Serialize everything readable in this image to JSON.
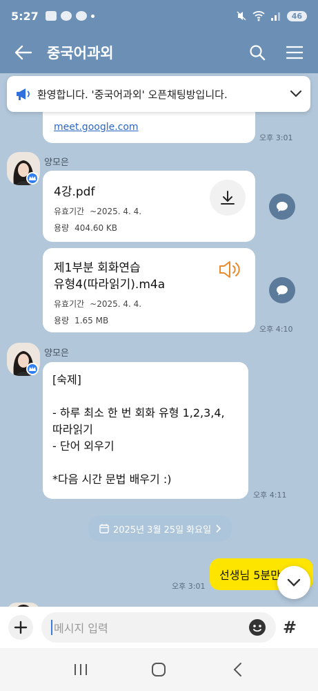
{
  "status_bar": {
    "time": "5:27",
    "battery": "46",
    "small_icon_text": "TALK"
  },
  "header": {
    "title": "중국어과외"
  },
  "notice": {
    "text": "환영합니다. '중국어과외' 오픈채팅방입니다."
  },
  "messages": {
    "link_message": {
      "link": "meet.google.com",
      "time": "오후 3:01"
    },
    "sender1": {
      "name": "양모은"
    },
    "file1": {
      "name": "4강.pdf",
      "expiry_label": "유효기간",
      "expiry_value": "~2025. 4. 4.",
      "size_label": "용량",
      "size_value": "404.60 KB"
    },
    "file2": {
      "name_line1": "제1부분 회화연습",
      "name_line2": "유형4(따라읽기).m4a",
      "expiry_label": "유효기간",
      "expiry_value": "~2025. 4. 4.",
      "size_label": "용량",
      "size_value": "1.65 MB",
      "time": "오후 4:10"
    },
    "sender2": {
      "name": "양모은"
    },
    "homework": {
      "line1": "[숙제]",
      "line2": "",
      "line3": "- 하루 최소 한 번 회화 유형 1,2,3,4,",
      "line4": "따라읽기",
      "line5": "- 단어 외우기",
      "line6": "",
      "line7": "*다음 시간 문법 배우기 :)",
      "time": "오후 4:11"
    },
    "date_divider": "2025년 3월 25일 화요일",
    "my_message": {
      "text": "선생님 5분만",
      "time": "오후 3:01"
    }
  },
  "input": {
    "placeholder": "메시지 입력"
  },
  "colors": {
    "chat_background": "#b2c7da",
    "header": "#6b8fb5",
    "my_bubble": "#fee500",
    "crown_badge": "#2f7ef2",
    "audio_icon": "#e8892a"
  }
}
